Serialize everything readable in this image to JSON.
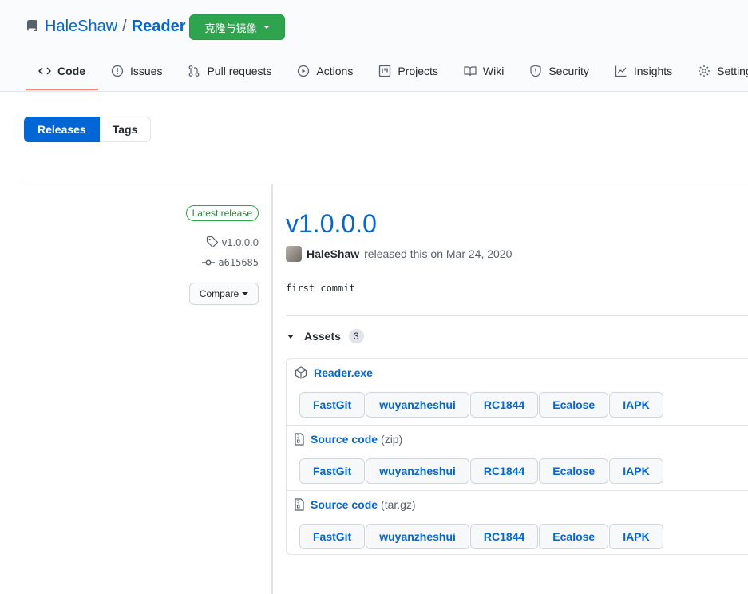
{
  "repo": {
    "owner": "HaleShaw",
    "separator": "/",
    "name": "Reader",
    "clone_label": "克隆与镜像"
  },
  "tabs": [
    {
      "label": "Code",
      "icon": "code-icon",
      "active": true
    },
    {
      "label": "Issues",
      "icon": "issue-icon"
    },
    {
      "label": "Pull requests",
      "icon": "pull-request-icon"
    },
    {
      "label": "Actions",
      "icon": "play-icon"
    },
    {
      "label": "Projects",
      "icon": "project-icon"
    },
    {
      "label": "Wiki",
      "icon": "book-icon"
    },
    {
      "label": "Security",
      "icon": "shield-icon"
    },
    {
      "label": "Insights",
      "icon": "graph-icon"
    },
    {
      "label": "Settings",
      "icon": "gear-icon"
    }
  ],
  "subnav": {
    "releases": "Releases",
    "tags": "Tags"
  },
  "sidebar": {
    "latest_badge": "Latest release",
    "tag": "v1.0.0.0",
    "commit": "a615685",
    "compare_label": "Compare"
  },
  "release": {
    "title": "v1.0.0.0",
    "author": "HaleShaw",
    "released_text": "released this on Mar 24, 2020",
    "body": "first commit",
    "assets_label": "Assets",
    "assets_count": "3",
    "assets": [
      {
        "name": "Reader.exe",
        "ext": "",
        "icon": "package-icon",
        "mirrors": [
          "FastGit",
          "wuyanzheshui",
          "RC1844",
          "Ecalose",
          "IAPK"
        ]
      },
      {
        "name": "Source code",
        "ext": "(zip)",
        "icon": "file-zip-icon",
        "mirrors": [
          "FastGit",
          "wuyanzheshui",
          "RC1844",
          "Ecalose",
          "IAPK"
        ]
      },
      {
        "name": "Source code",
        "ext": "(tar.gz)",
        "icon": "file-zip-icon",
        "mirrors": [
          "FastGit",
          "wuyanzheshui",
          "RC1844",
          "Ecalose",
          "IAPK"
        ]
      }
    ]
  },
  "colors": {
    "link": "#0366d6",
    "clone_button": "#2ea44f",
    "active_tab_underline": "#f9826c",
    "latest_badge": "#28a745"
  }
}
